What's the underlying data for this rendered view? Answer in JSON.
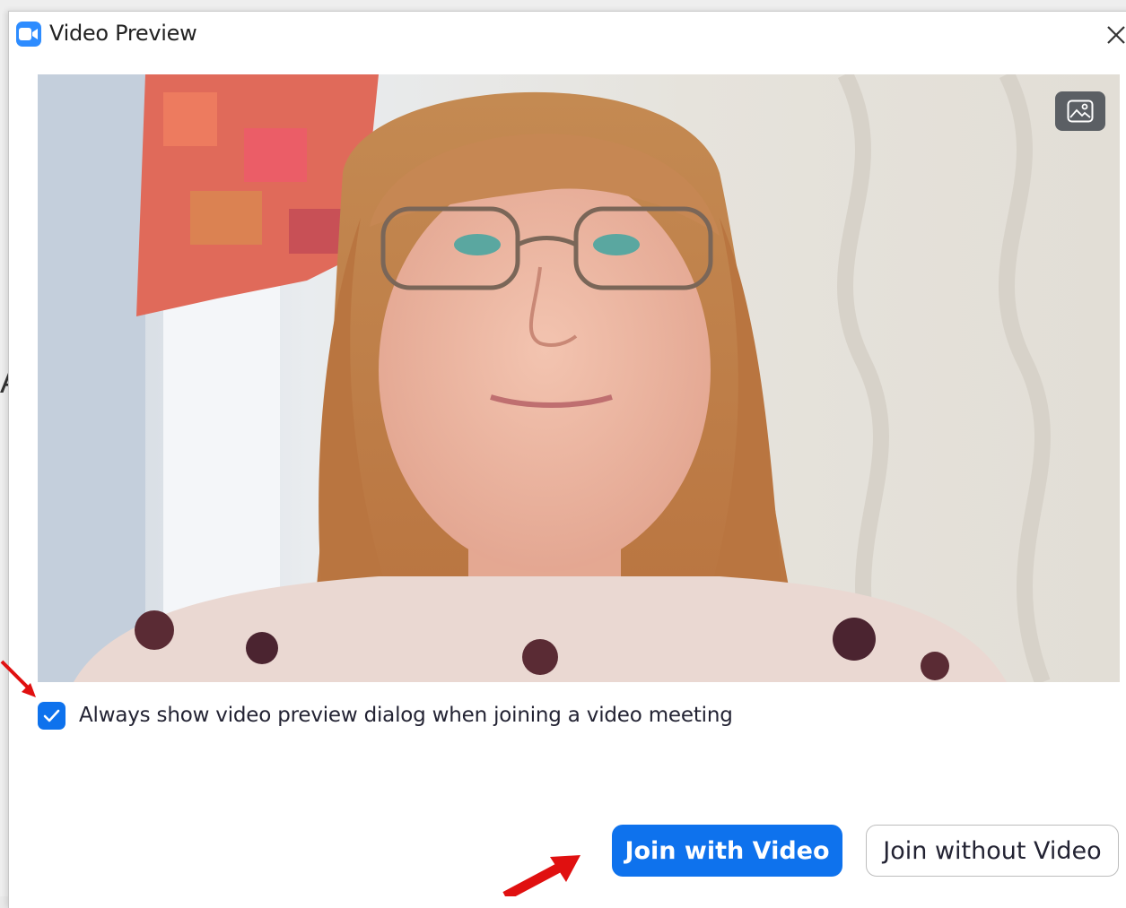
{
  "dialog": {
    "title": "Video Preview",
    "app_icon": "zoom-camera-icon",
    "close_icon": "close-icon",
    "accent_color": "#0e72ed"
  },
  "video": {
    "background_toggle_icon": "image-icon"
  },
  "options": {
    "always_show_preview_label": "Always show video preview dialog when joining a video meeting",
    "always_show_preview_checked": true
  },
  "actions": {
    "join_with_video_label": "Join with Video",
    "join_without_video_label": "Join without Video"
  },
  "background_window": {
    "fragment_text": "A"
  },
  "annotations": {
    "arrow_color": "#e01010"
  }
}
